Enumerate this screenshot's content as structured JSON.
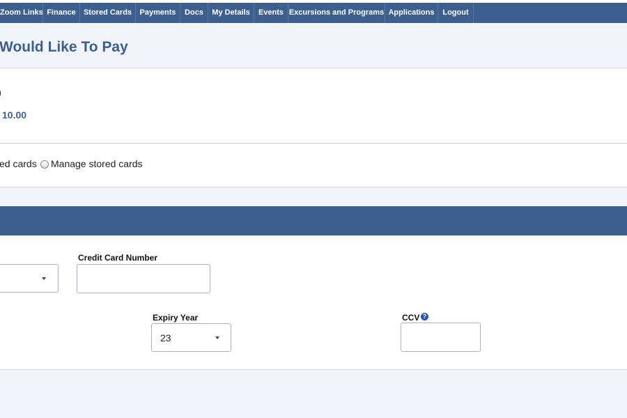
{
  "nav": {
    "items": [
      {
        "label": "Zoom Links"
      },
      {
        "label": "Finance"
      },
      {
        "label": "Stored Cards"
      },
      {
        "label": "Payments"
      },
      {
        "label": "Docs"
      },
      {
        "label": "My Details"
      },
      {
        "label": "Events"
      },
      {
        "label": "Excursions and Programs"
      },
      {
        "label": "Applications"
      },
      {
        "label": "Logout"
      }
    ]
  },
  "page": {
    "title": "Would Like To Pay"
  },
  "payment": {
    "label_fragment": "n",
    "amount": "10.00"
  },
  "card_options": {
    "use_stored_fragment": "ed cards",
    "manage_label": "Manage stored cards"
  },
  "card_form": {
    "card_number_label": "Credit Card Number",
    "card_number_value": "",
    "expiry_year_label": "Expiry Year",
    "expiry_year_value": "23",
    "ccv_label": "CCV",
    "ccv_value": "",
    "help_glyph": "?"
  },
  "colors": {
    "nav_bg": "#3c5f8f",
    "accent": "#3c5f8f",
    "page_bg": "#f1f4f8"
  }
}
